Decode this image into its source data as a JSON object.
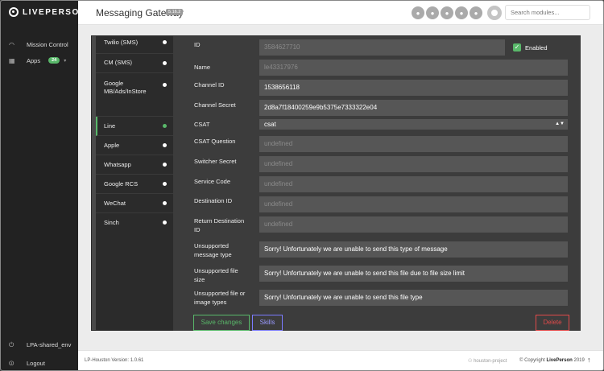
{
  "app": {
    "logo_text": "LIVEPERSON",
    "title": "Messaging Gateway",
    "version_badge": "5.16.2"
  },
  "sidebar": {
    "items": [
      {
        "icon": "dashboard-icon",
        "label": "Mission Control"
      },
      {
        "icon": "grid-icon",
        "label": "Apps",
        "badge": "24"
      }
    ],
    "bottom": [
      {
        "icon": "power-icon",
        "label": "LPA-shared_env"
      },
      {
        "icon": "logout-icon",
        "label": "Logout"
      }
    ]
  },
  "header": {
    "search_placeholder": "Search modules...",
    "avatar_count": 5
  },
  "channels": [
    {
      "label": "Twilio (SMS)"
    },
    {
      "label": "CM (SMS)"
    },
    {
      "label": "Google MB/Ads/InStore"
    },
    {
      "label": "Line",
      "active": true
    },
    {
      "label": "Apple"
    },
    {
      "label": "Whatsapp"
    },
    {
      "label": "Google RCS"
    },
    {
      "label": "WeChat"
    },
    {
      "label": "Sinch"
    }
  ],
  "form": {
    "id_label": "ID",
    "id_value": "3584627710",
    "enabled_label": "Enabled",
    "enabled": true,
    "name_label": "Name",
    "name_value": "le43317976",
    "channel_id_label": "Channel ID",
    "channel_id_value": "1538656118",
    "channel_secret_label": "Channel Secret",
    "channel_secret_value": "2d8a7f18400259e9b5375e7333322e04",
    "csat_label": "CSAT",
    "csat_value": "csat",
    "csat_question_label": "CSAT Question",
    "csat_question_value": "undefined",
    "switcher_secret_label": "Switcher Secret",
    "switcher_secret_value": "undefined",
    "service_code_label": "Service Code",
    "service_code_value": "undefined",
    "destination_id_label": "Destination ID",
    "destination_id_value": "undefined",
    "return_destination_id_label_1": "Return Destination",
    "return_destination_id_label_2": "ID",
    "return_destination_id_value": "undefined",
    "unsupported_msg_label_1": "Unsupported",
    "unsupported_msg_label_2": "message type",
    "unsupported_msg_value": "Sorry! Unfortunately we are unable to send this type of message",
    "unsupported_size_label_1": "Unsupported file",
    "unsupported_size_label_2": "size",
    "unsupported_size_value": "Sorry! Unfortunately we are unable to send this file due to file size limit",
    "unsupported_type_label_1": "Unsupported file or",
    "unsupported_type_label_2": "image types",
    "unsupported_type_value": "Sorry! Unfortunately we are unable to send this file type"
  },
  "buttons": {
    "save": "Save changes",
    "skills": "Skills",
    "delete": "Delete"
  },
  "footer": {
    "version": "LP-Houston Version: 1.0.61",
    "project": "houston-project",
    "copyright_prefix": "© Copyright",
    "copyright_brand": "LivePerson",
    "copyright_year": "2019"
  },
  "colors": {
    "accent_green": "#59b86a",
    "skills_blue": "#7b7bff",
    "delete_red": "#e04a4a"
  }
}
